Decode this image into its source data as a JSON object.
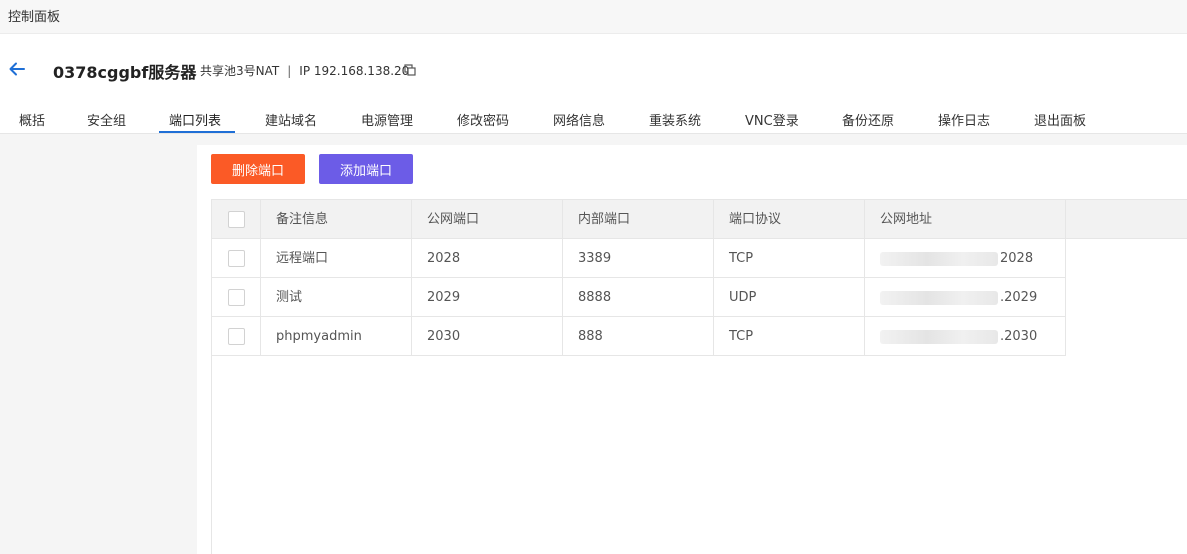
{
  "app": {
    "title": "控制面板"
  },
  "header": {
    "server_name": "0378cggbf服务器",
    "pool": "共享池3号NAT",
    "separator": "|",
    "ip_label": "IP 192.168.138.20"
  },
  "tabs": [
    {
      "label": "概括"
    },
    {
      "label": "安全组"
    },
    {
      "label": "端口列表"
    },
    {
      "label": "建站域名"
    },
    {
      "label": "电源管理"
    },
    {
      "label": "修改密码"
    },
    {
      "label": "网络信息"
    },
    {
      "label": "重装系统"
    },
    {
      "label": "VNC登录"
    },
    {
      "label": "备份还原"
    },
    {
      "label": "操作日志"
    },
    {
      "label": "退出面板"
    }
  ],
  "active_tab": "端口列表",
  "toolbar": {
    "delete_label": "删除端口",
    "add_label": "添加端口"
  },
  "table": {
    "columns": [
      "备注信息",
      "公网端口",
      "内部端口",
      "端口协议",
      "公网地址"
    ],
    "rows": [
      {
        "note": "远程端口",
        "public_port": "2028",
        "internal_port": "3389",
        "protocol": "TCP",
        "address_suffix": "2028"
      },
      {
        "note": "测试",
        "public_port": "2029",
        "internal_port": "8888",
        "protocol": "UDP",
        "address_suffix": ".2029"
      },
      {
        "note": "phpmyadmin",
        "public_port": "2030",
        "internal_port": "888",
        "protocol": "TCP",
        "address_suffix": ".2030"
      }
    ]
  },
  "colors": {
    "delete_button": "#fb5a26",
    "add_button": "#6c5ce7",
    "active_tab_underline": "#1f6fd6",
    "back_arrow": "#1f6fd6"
  },
  "icons": {
    "back": "arrow-left-icon",
    "copy": "copy-icon"
  }
}
